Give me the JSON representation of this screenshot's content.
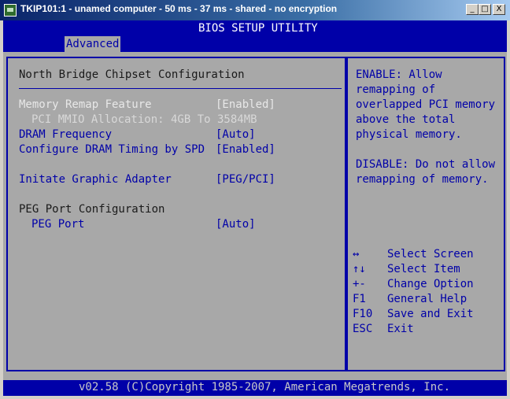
{
  "window": {
    "title": "TKIP101:1 - unamed computer - 50 ms - 37 ms - shared - no encryption",
    "minimize": "_",
    "maximize": "□",
    "close": "X"
  },
  "bios": {
    "title": "BIOS SETUP UTILITY",
    "tab": "Advanced",
    "section_title": "North Bridge Chipset Configuration",
    "settings": [
      {
        "label": "Memory Remap Feature",
        "value": "[Enabled]"
      },
      {
        "label": "PCI MMIO Allocation: 4GB To 3584MB"
      },
      {
        "label": "DRAM Frequency",
        "value": "[Auto]"
      },
      {
        "label": "Configure DRAM Timing by SPD",
        "value": "[Enabled]"
      },
      {
        "label": "Initate Graphic Adapter",
        "value": "[PEG/PCI]"
      },
      {
        "label": "PEG Port Configuration"
      },
      {
        "label": "PEG Port",
        "value": "[Auto]"
      }
    ],
    "help_lines": [
      "ENABLE: Allow",
      "remapping of",
      "overlapped PCI memory",
      "above the total",
      "physical memory.",
      "DISABLE: Do not allow",
      "remapping of memory."
    ],
    "keys": [
      {
        "key": "↔",
        "desc": "Select Screen"
      },
      {
        "key": "↑↓",
        "desc": "Select Item"
      },
      {
        "key": "+-",
        "desc": "Change Option"
      },
      {
        "key": "F1",
        "desc": "General Help"
      },
      {
        "key": "F10",
        "desc": "Save and Exit"
      },
      {
        "key": "ESC",
        "desc": "Exit"
      }
    ],
    "footer": "v02.58 (C)Copyright 1985-2007, American Megatrends, Inc."
  },
  "colors": {
    "bios_blue": "#0000a8",
    "panel_gray": "#a8a8a8",
    "highlight_text": "#e8e8e8"
  }
}
